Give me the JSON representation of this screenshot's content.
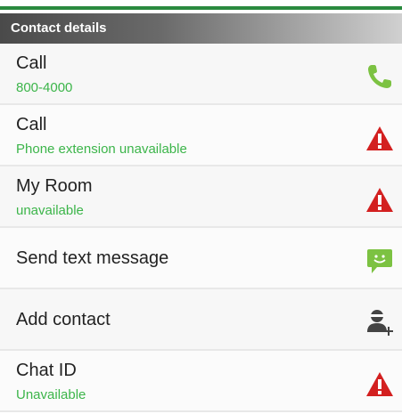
{
  "header": {
    "title": "Contact details"
  },
  "rows": [
    {
      "title": "Call",
      "subtitle": "800-4000",
      "icon": "phone-icon"
    },
    {
      "title": "Call",
      "subtitle": "Phone extension unavailable",
      "icon": "warning-icon"
    },
    {
      "title": "My Room",
      "subtitle": "unavailable",
      "icon": "warning-icon"
    },
    {
      "title": "Send text message",
      "subtitle": "",
      "icon": "message-icon"
    },
    {
      "title": "Add contact",
      "subtitle": "",
      "icon": "add-contact-icon"
    },
    {
      "title": "Chat ID",
      "subtitle": "Unavailable",
      "icon": "warning-icon"
    }
  ],
  "colors": {
    "accent_green": "#3cb54a",
    "warning_red": "#d32020",
    "top_bar": "#2a8a3e"
  }
}
